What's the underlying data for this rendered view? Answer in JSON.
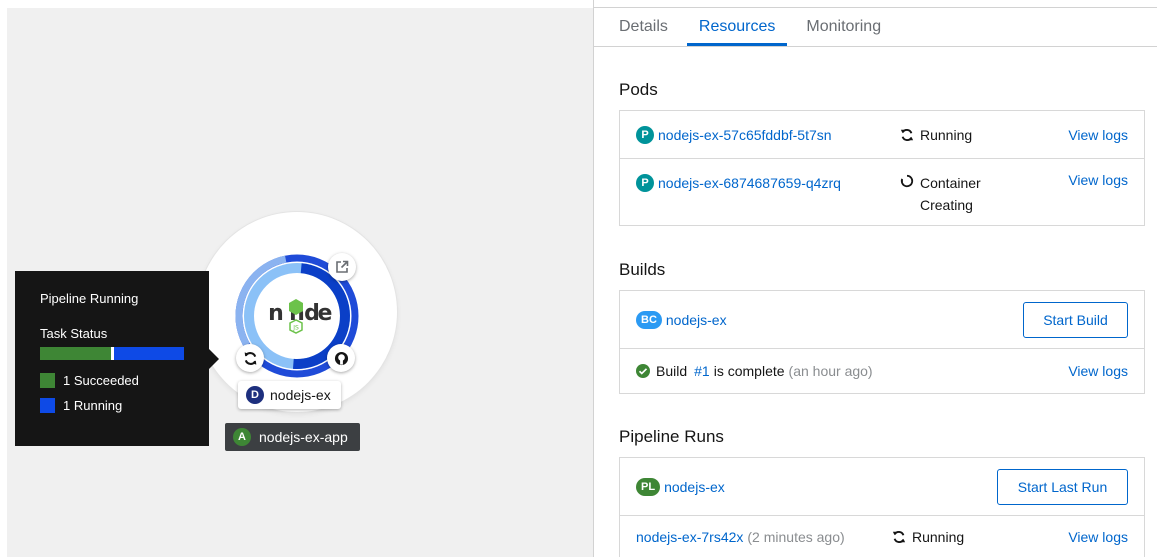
{
  "topology": {
    "tooltip": {
      "title": "Pipeline Running",
      "task_status_label": "Task Status",
      "legend": [
        {
          "label": "1 Succeeded",
          "color": "#3e8635"
        },
        {
          "label": "1 Running",
          "color": "#0e4ae6"
        }
      ]
    },
    "node": {
      "logo_icon": "nodejs-logo-icon",
      "badge": "D",
      "name": "nodejs-ex",
      "decorators": [
        "external-link-icon",
        "github-icon",
        "build-sync-icon"
      ]
    },
    "application": {
      "badge": "A",
      "name": "nodejs-ex-app"
    }
  },
  "panel": {
    "tabs": [
      {
        "label": "Details",
        "active": false
      },
      {
        "label": "Resources",
        "active": true
      },
      {
        "label": "Monitoring",
        "active": false
      }
    ],
    "pods": {
      "title": "Pods",
      "items": [
        {
          "badge": "P",
          "name": "nodejs-ex-57c65fddbf-5t7sn",
          "status": "Running",
          "status_icon": "sync-icon",
          "action": "View logs"
        },
        {
          "badge": "P",
          "name": "nodejs-ex-6874687659-q4zrq",
          "status_line1": "Container",
          "status_line2": "Creating",
          "status_icon": "spinner-icon",
          "action": "View logs"
        }
      ]
    },
    "builds": {
      "title": "Builds",
      "config": {
        "badge": "BC",
        "name": "nodejs-ex",
        "action": "Start Build"
      },
      "latest": {
        "prefix": "Build",
        "number": "#1",
        "text": "is complete",
        "time": "(an hour ago)",
        "action": "View logs"
      }
    },
    "pipeline_runs": {
      "title": "Pipeline Runs",
      "pipeline": {
        "badge": "PL",
        "name": "nodejs-ex",
        "action": "Start Last Run"
      },
      "run": {
        "name": "nodejs-ex-7rs42x",
        "time": "(2 minutes ago)",
        "status": "Running",
        "action": "View logs"
      }
    }
  },
  "colors": {
    "link": "#06c",
    "succeeded": "#3e8635",
    "running": "#0e4ae6"
  }
}
